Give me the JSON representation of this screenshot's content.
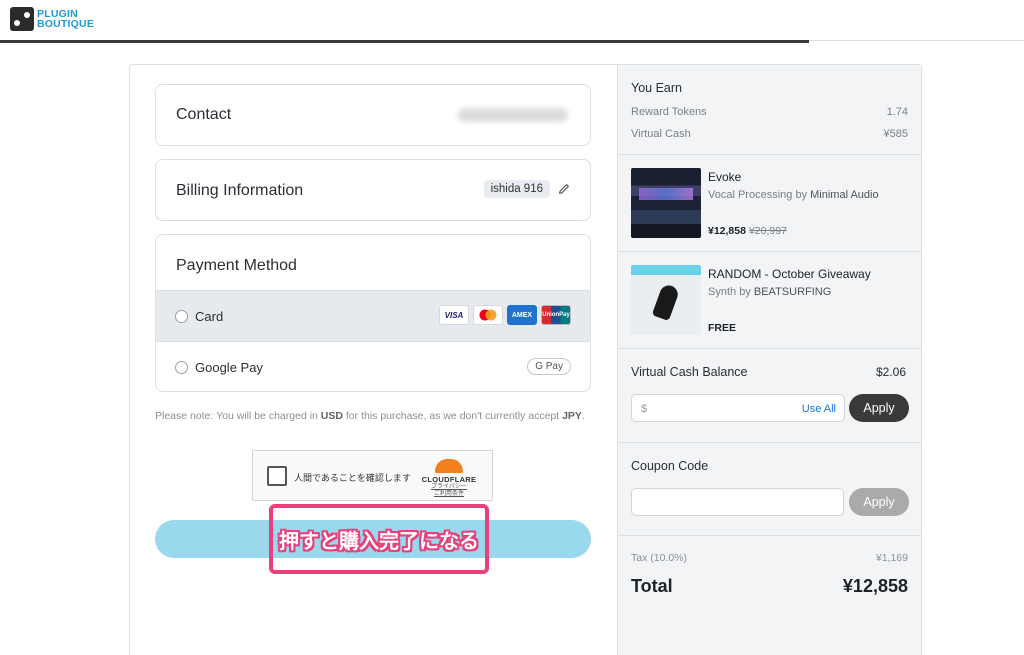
{
  "header": {
    "logo_line1": "PLUGIN",
    "logo_line2": "BOUTIQUE",
    "checkout_progress": 0.79
  },
  "contact": {
    "title": "Contact"
  },
  "billing": {
    "title": "Billing Information",
    "user": "ishida 916"
  },
  "payment": {
    "title": "Payment Method",
    "options": [
      {
        "label": "Card",
        "selected": true
      },
      {
        "label": "Google Pay",
        "selected": false
      }
    ],
    "card_brands": [
      "VISA",
      "Mastercard",
      "AMEX",
      "UnionPay"
    ],
    "gpay_badge": "G Pay"
  },
  "note": {
    "prefix": "Please note: You will be charged in ",
    "currency": "USD",
    "middle": " for this purchase, as we don't currently accept ",
    "local_currency": "JPY",
    "suffix": "."
  },
  "captcha": {
    "label": "人間であることを確認します",
    "provider": "CLOUDFLARE",
    "link1": "プライバシー",
    "link2": "ご利用条件"
  },
  "annotation": {
    "text": "押すと購入完了になる",
    "color": "#e8407a"
  },
  "summary": {
    "you_earn": {
      "title": "You Earn",
      "reward_tokens_label": "Reward Tokens",
      "reward_tokens_value": "1.74",
      "virtual_cash_label": "Virtual Cash",
      "virtual_cash_value": "¥585"
    },
    "products": [
      {
        "name": "Evoke",
        "category": "Vocal Processing",
        "by": " by ",
        "brand": "Minimal Audio",
        "price": "¥12,858",
        "old_price": "¥20,997"
      },
      {
        "name": "RANDOM - October Giveaway",
        "category": "Synth",
        "by": " by ",
        "brand": "BEATSURFING",
        "price": "FREE",
        "old_price": ""
      }
    ],
    "virtual_cash_balance": {
      "title": "Virtual Cash Balance",
      "amount": "$2.06",
      "prefix": "$",
      "use_all": "Use All",
      "apply": "Apply"
    },
    "coupon": {
      "title": "Coupon Code",
      "apply": "Apply"
    },
    "tax_label": "Tax (10.0%)",
    "tax_value": "¥1,169",
    "total_label": "Total",
    "total_value": "¥12,858"
  },
  "colors": {
    "brand": "#1a9bd7",
    "place_order_button": "#9ad8ee",
    "link": "#1a73d8"
  }
}
